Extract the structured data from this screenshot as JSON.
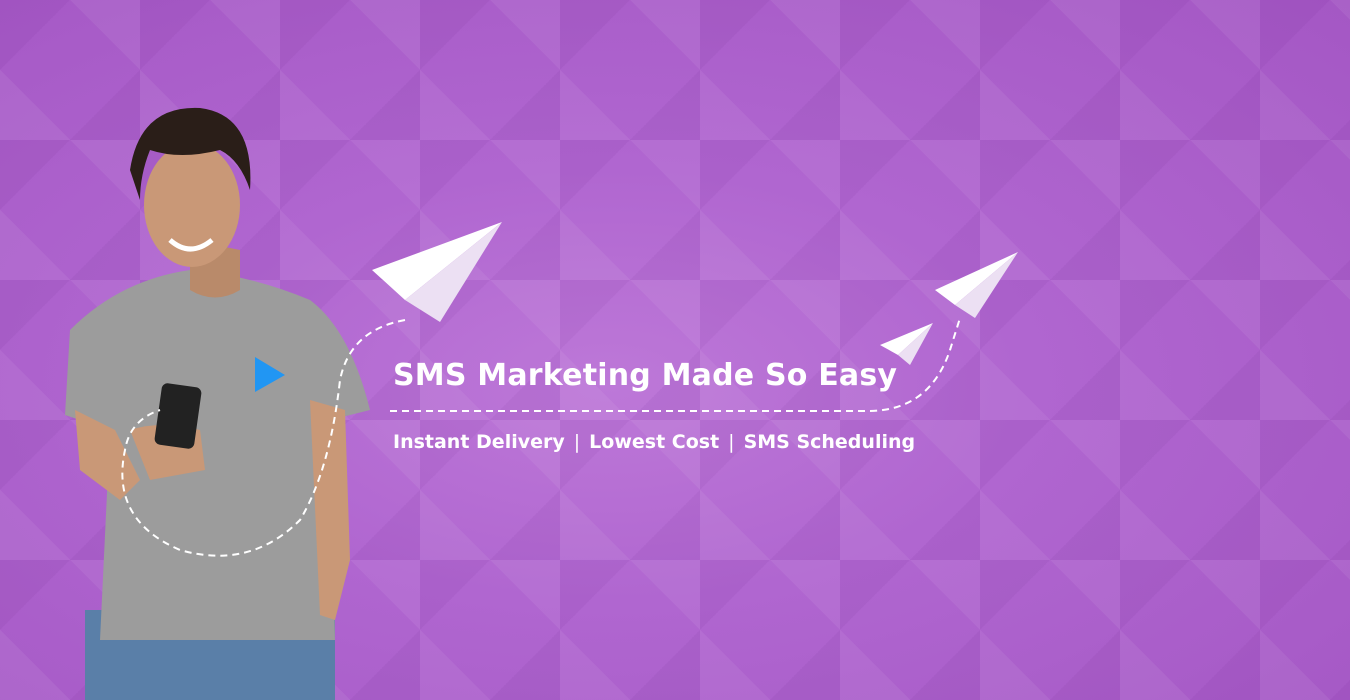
{
  "banner": {
    "headline": "SMS Marketing Made So Easy",
    "features": [
      "Instant Delivery",
      "Lowest Cost",
      "SMS Scheduling"
    ],
    "separator": "|",
    "colors": {
      "background": "#b066d0",
      "text": "#ffffff",
      "logo": "#2196f3",
      "shirt": "#9a9a9a"
    }
  }
}
